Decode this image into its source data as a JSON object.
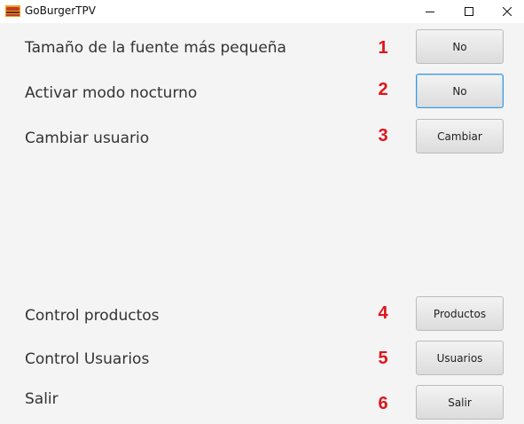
{
  "window": {
    "title": "GoBurgerTPV",
    "icon": "burger-logo-icon",
    "controls": [
      "minimize-icon",
      "maximize-icon",
      "close-icon"
    ]
  },
  "colors": {
    "number_accent": "#e0141b",
    "focus_border": "#3e97d7",
    "background": "#f4f4f4"
  },
  "rows": [
    {
      "label": "Tamaño de la fuente más pequeña",
      "number": "1",
      "button": "No"
    },
    {
      "label": "Activar modo nocturno",
      "number": "2",
      "button": "No"
    },
    {
      "label": "Cambiar usuario",
      "number": "3",
      "button": "Cambiar"
    },
    {
      "label": "Control productos",
      "number": "4",
      "button": "Productos"
    },
    {
      "label": "Control Usuarios",
      "number": "5",
      "button": "Usuarios"
    },
    {
      "label": "Salir",
      "number": "6",
      "button": "Salir"
    }
  ]
}
